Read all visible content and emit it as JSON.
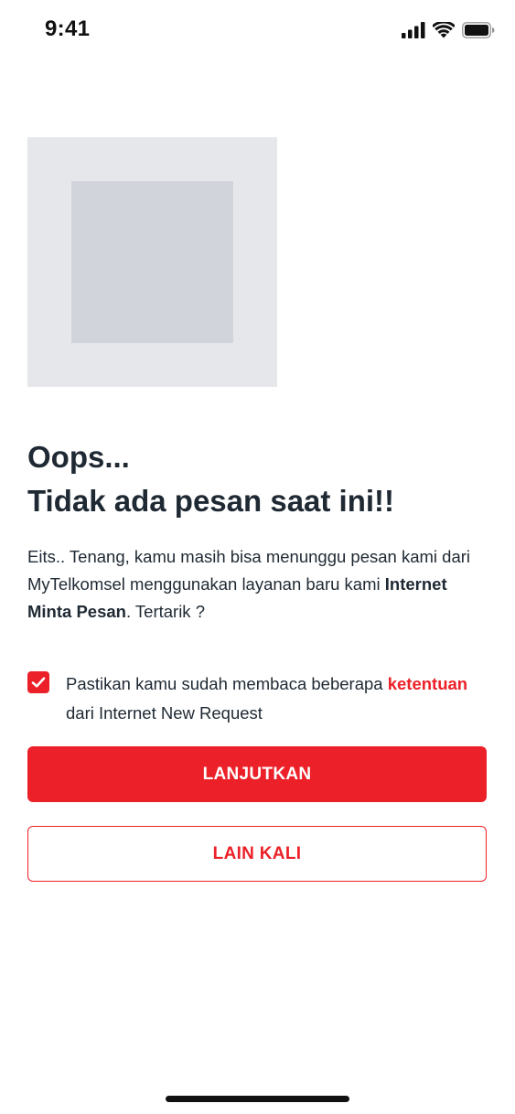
{
  "status_bar": {
    "time": "9:41",
    "icons": [
      "cellular-signal-icon",
      "wifi-icon",
      "battery-icon"
    ]
  },
  "illustration": {
    "icon": "image-placeholder-icon"
  },
  "headline": {
    "line1": "Oops...",
    "line2": "Tidak ada pesan saat ini!!"
  },
  "description": {
    "text_before": "Eits.. Tenang, kamu masih bisa menunggu pesan kami dari MyTelkomsel menggunakan layanan baru kami ",
    "bold_text": "Internet Minta Pesan",
    "text_after": ". Tertarik ?"
  },
  "consent": {
    "checked": true,
    "text_before": "Pastikan kamu sudah membaca beberapa ",
    "link_text": "ketentuan",
    "text_after": " dari Internet New Request"
  },
  "buttons": {
    "primary_label": "LANJUTKAN",
    "secondary_label": "LAIN KALI"
  },
  "colors": {
    "accent": "#ec2028",
    "text": "#1f2933",
    "placeholder_outer": "#e5e7eb",
    "placeholder_inner": "#d1d5db"
  }
}
